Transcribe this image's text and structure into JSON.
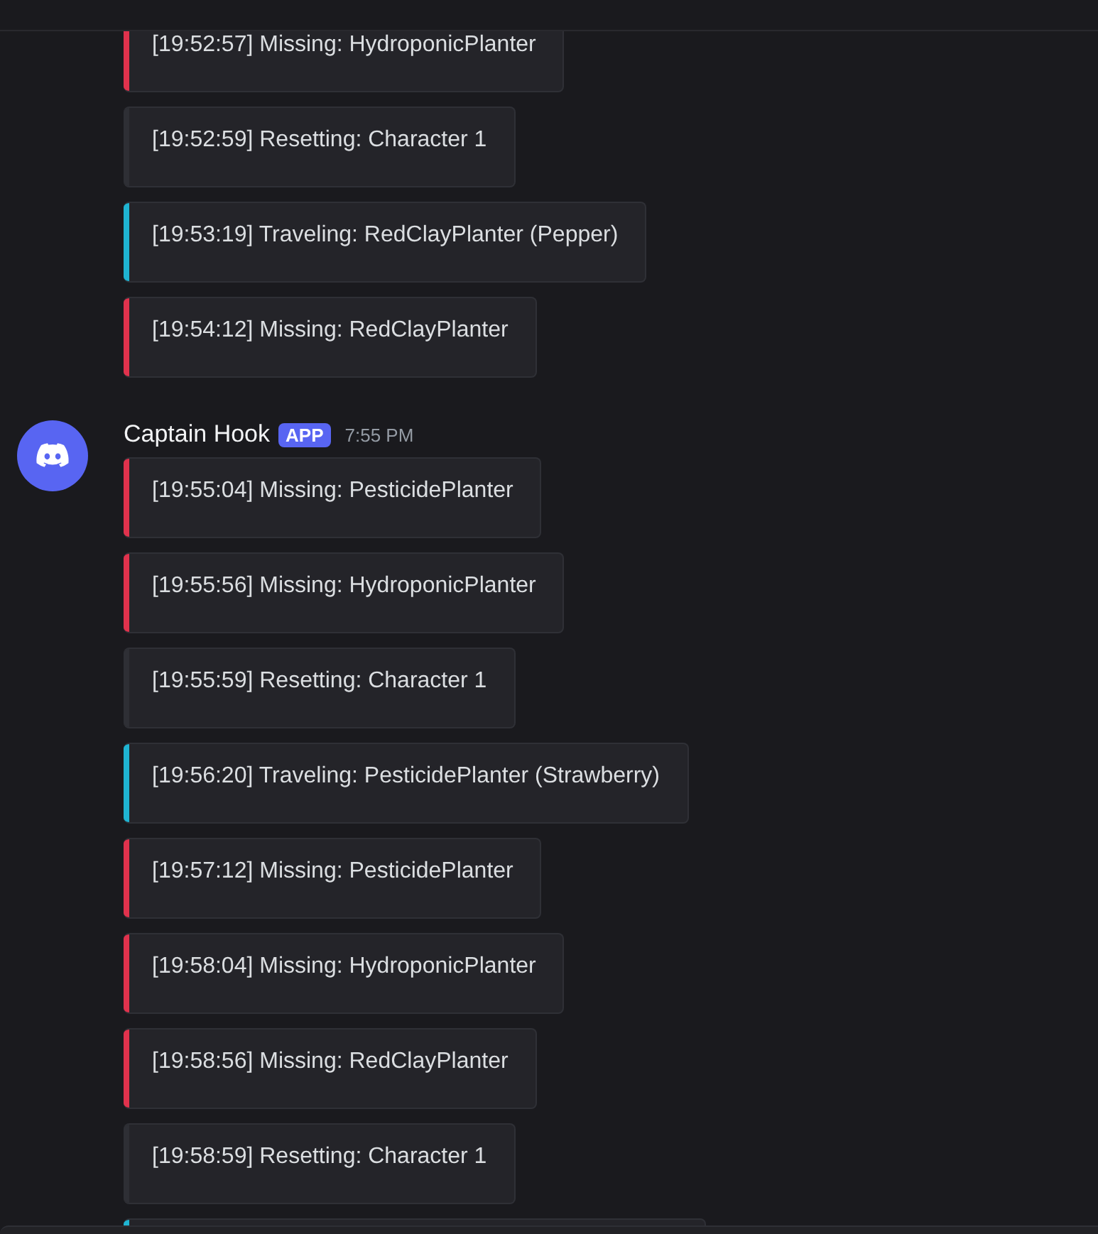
{
  "groups": [
    {
      "embeds": [
        {
          "text": "[19:52:57] Missing: HydroponicPlanter",
          "color": "#e0324d"
        },
        {
          "text": "[19:52:59] Resetting: Character 1",
          "color": "#2e2f35"
        },
        {
          "text": "[19:53:19] Traveling: RedClayPlanter (Pepper)",
          "color": "#1fb4d2"
        },
        {
          "text": "[19:54:12] Missing: RedClayPlanter",
          "color": "#e0324d"
        }
      ]
    },
    {
      "author": {
        "name": "Captain Hook",
        "badge": "APP",
        "time": "7:55 PM"
      },
      "embeds": [
        {
          "text": "[19:55:04] Missing: PesticidePlanter",
          "color": "#e0324d"
        },
        {
          "text": "[19:55:56] Missing: HydroponicPlanter",
          "color": "#e0324d"
        },
        {
          "text": "[19:55:59] Resetting: Character 1",
          "color": "#2e2f35"
        },
        {
          "text": "[19:56:20] Traveling: PesticidePlanter (Strawberry)",
          "color": "#1fb4d2"
        },
        {
          "text": "[19:57:12] Missing: PesticidePlanter",
          "color": "#e0324d"
        },
        {
          "text": "[19:58:04] Missing: HydroponicPlanter",
          "color": "#e0324d"
        },
        {
          "text": "[19:58:56] Missing: RedClayPlanter",
          "color": "#e0324d"
        },
        {
          "text": "[19:58:59] Resetting: Character 1",
          "color": "#2e2f35"
        },
        {
          "color": "#1fb4d2"
        }
      ]
    }
  ]
}
